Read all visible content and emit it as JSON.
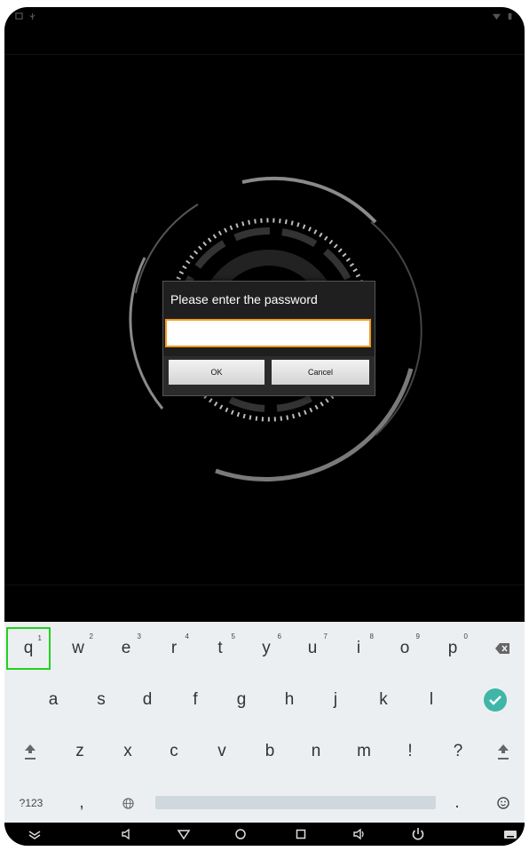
{
  "dialog": {
    "title": "Please enter the password",
    "password_value": "",
    "ok_label": "OK",
    "cancel_label": "Cancel"
  },
  "keyboard": {
    "row1": [
      {
        "key": "q",
        "hint": "1"
      },
      {
        "key": "w",
        "hint": "2"
      },
      {
        "key": "e",
        "hint": "3"
      },
      {
        "key": "r",
        "hint": "4"
      },
      {
        "key": "t",
        "hint": "5"
      },
      {
        "key": "y",
        "hint": "6"
      },
      {
        "key": "u",
        "hint": "7"
      },
      {
        "key": "i",
        "hint": "8"
      },
      {
        "key": "o",
        "hint": "9"
      },
      {
        "key": "p",
        "hint": "0"
      }
    ],
    "row2": [
      "a",
      "s",
      "d",
      "f",
      "g",
      "h",
      "j",
      "k",
      "l"
    ],
    "row3": [
      "z",
      "x",
      "c",
      "v",
      "b",
      "n",
      "m",
      "!",
      "?"
    ],
    "row4": {
      "symbols": "?123",
      "comma": ",",
      "period": "."
    }
  },
  "icons": {
    "backspace": "backspace-icon",
    "enter": "checkmark-icon",
    "shift": "shift-arrow-icon",
    "globe": "globe-icon",
    "emoji": "smiley-icon",
    "nav_back": "chevron-down-icon",
    "nav_volume_down": "volume-down-icon",
    "nav_back_triangle": "triangle-back-icon",
    "nav_home": "circle-home-icon",
    "nav_recent": "square-recent-icon",
    "nav_volume_up": "volume-up-icon",
    "nav_power": "power-icon",
    "nav_keyboard": "keyboard-icon"
  },
  "colors": {
    "dialog_input_border": "#f39a1e",
    "enter_key": "#3fb6a8",
    "highlight": "#22d11e",
    "keyboard_bg": "#eceff1"
  }
}
